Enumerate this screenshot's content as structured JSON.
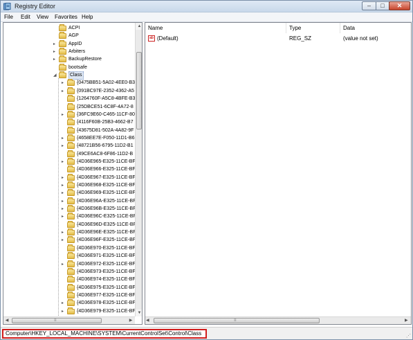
{
  "window": {
    "title": "Registry Editor",
    "icons": {
      "app": "registry-editor-icon"
    },
    "controls": {
      "minimize": "–",
      "maximize": "□",
      "close": "✕"
    }
  },
  "menu": [
    "File",
    "Edit",
    "View",
    "Favorites",
    "Help"
  ],
  "tree": {
    "rows": [
      {
        "label": "ACPI",
        "expander": "",
        "selected": false
      },
      {
        "label": "AGP",
        "expander": "",
        "selected": false
      },
      {
        "label": "AppID",
        "expander": "▸",
        "selected": false
      },
      {
        "label": "Arbiters",
        "expander": "▸",
        "selected": false
      },
      {
        "label": "BackupRestore",
        "expander": "▸",
        "selected": false
      },
      {
        "label": "bootsafe",
        "expander": "",
        "selected": false
      },
      {
        "label": "Class",
        "expander": "◢",
        "selected": true
      },
      {
        "label": "{0475BB51-5A02-4EE0-B3",
        "expander": "▸",
        "selected": false,
        "indent": 1
      },
      {
        "label": "{091BC97E-2352-4362-A5",
        "expander": "▸",
        "selected": false,
        "indent": 1
      },
      {
        "label": "{1264760F-A5C8-4BFE-B3",
        "expander": "",
        "selected": false,
        "indent": 1
      },
      {
        "label": "{25DBCE51-6C8F-4A72-8",
        "expander": "",
        "selected": false,
        "indent": 1
      },
      {
        "label": "{36FC9E60-C465-11CF-80",
        "expander": "▸",
        "selected": false,
        "indent": 1
      },
      {
        "label": "{4116F60B-25B3-4662-B7",
        "expander": "",
        "selected": false,
        "indent": 1
      },
      {
        "label": "{43675D81-502A-4A82-9F",
        "expander": "",
        "selected": false,
        "indent": 1
      },
      {
        "label": "{4658EE7E-F050-11D1-B6",
        "expander": "▸",
        "selected": false,
        "indent": 1
      },
      {
        "label": "{48721B56-6795-11D2-B1",
        "expander": "▸",
        "selected": false,
        "indent": 1
      },
      {
        "label": "{49CE6AC8-6F86-11D2-B",
        "expander": "",
        "selected": false,
        "indent": 1
      },
      {
        "label": "{4D36E965-E325-11CE-BF",
        "expander": "▸",
        "selected": false,
        "indent": 1
      },
      {
        "label": "{4D36E966-E325-11CE-BF",
        "expander": "",
        "selected": false,
        "indent": 1
      },
      {
        "label": "{4D36E967-E325-11CE-BF",
        "expander": "▸",
        "selected": false,
        "indent": 1
      },
      {
        "label": "{4D36E968-E325-11CE-BF",
        "expander": "▸",
        "selected": false,
        "indent": 1
      },
      {
        "label": "{4D36E969-E325-11CE-BF",
        "expander": "▸",
        "selected": false,
        "indent": 1
      },
      {
        "label": "{4D36E96A-E325-11CE-BF",
        "expander": "▸",
        "selected": false,
        "indent": 1
      },
      {
        "label": "{4D36E96B-E325-11CE-BF",
        "expander": "▸",
        "selected": false,
        "indent": 1
      },
      {
        "label": "{4D36E96C-E325-11CE-BF",
        "expander": "▸",
        "selected": false,
        "indent": 1
      },
      {
        "label": "{4D36E96D-E325-11CE-BF",
        "expander": "",
        "selected": false,
        "indent": 1
      },
      {
        "label": "{4D36E96E-E325-11CE-BF",
        "expander": "▸",
        "selected": false,
        "indent": 1
      },
      {
        "label": "{4D36E96F-E325-11CE-BF",
        "expander": "▸",
        "selected": false,
        "indent": 1
      },
      {
        "label": "{4D36E970-E325-11CE-BF",
        "expander": "",
        "selected": false,
        "indent": 1
      },
      {
        "label": "{4D36E971-E325-11CE-BF",
        "expander": "",
        "selected": false,
        "indent": 1
      },
      {
        "label": "{4D36E972-E325-11CE-BF",
        "expander": "▸",
        "selected": false,
        "indent": 1
      },
      {
        "label": "{4D36E973-E325-11CE-BF",
        "expander": "",
        "selected": false,
        "indent": 1
      },
      {
        "label": "{4D36E974-E325-11CE-BF",
        "expander": "",
        "selected": false,
        "indent": 1
      },
      {
        "label": "{4D36E975-E325-11CE-BF",
        "expander": "",
        "selected": false,
        "indent": 1
      },
      {
        "label": "{4D36E977-E325-11CE-BF",
        "expander": "",
        "selected": false,
        "indent": 1
      },
      {
        "label": "{4D36E978-E325-11CE-BF",
        "expander": "▸",
        "selected": false,
        "indent": 1
      },
      {
        "label": "{4D36E979-E325-11CE-BF",
        "expander": "▸",
        "selected": false,
        "indent": 1
      }
    ],
    "scroll": {
      "up": "▲",
      "down": "▼",
      "left": "◀",
      "right": "▶",
      "grip": "≡"
    }
  },
  "values": {
    "columns": [
      "Name",
      "Type",
      "Data"
    ],
    "rows": [
      {
        "icon": "ab",
        "name": "(Default)",
        "type": "REG_SZ",
        "data": "(value not set)"
      }
    ],
    "scroll": {
      "left": "◀",
      "right": "▶",
      "grip": "≡"
    }
  },
  "status": {
    "path": "Computer\\HKEY_LOCAL_MACHINE\\SYSTEM\\CurrentControlSet\\Control\\Class",
    "highlight_color": "#d11c1c",
    "grip": "⋰"
  }
}
